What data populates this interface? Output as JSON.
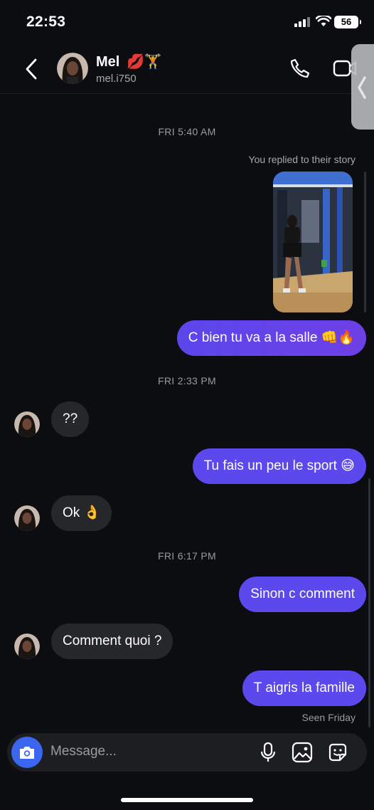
{
  "status_bar": {
    "time": "22:53",
    "battery": "56"
  },
  "header": {
    "name": "Mel",
    "emoji": "💋🏋",
    "username": "mel.i750"
  },
  "chat": {
    "separators": [
      "FRI 5:40 AM",
      "FRI 2:33 PM",
      "FRI 6:17 PM"
    ],
    "story_reply_note": "You replied to their story",
    "messages": [
      {
        "direction": "outgoing",
        "text": "C bien tu va a la salle 👊🔥"
      },
      {
        "direction": "incoming",
        "text": "??"
      },
      {
        "direction": "outgoing",
        "text": "Tu fais un peu le sport 😅"
      },
      {
        "direction": "incoming",
        "text": "Ok 👌"
      },
      {
        "direction": "outgoing",
        "text": "Sinon c comment"
      },
      {
        "direction": "incoming",
        "text": "Comment quoi ?"
      },
      {
        "direction": "outgoing",
        "text": "T aigris la famille"
      }
    ],
    "seen": "Seen Friday"
  },
  "composer": {
    "placeholder": "Message..."
  },
  "colors": {
    "background": "#0c0d10",
    "outgoing_bubble": "#5b49ee",
    "incoming_bubble": "#26272b",
    "camera_button": "#3a66f0"
  }
}
